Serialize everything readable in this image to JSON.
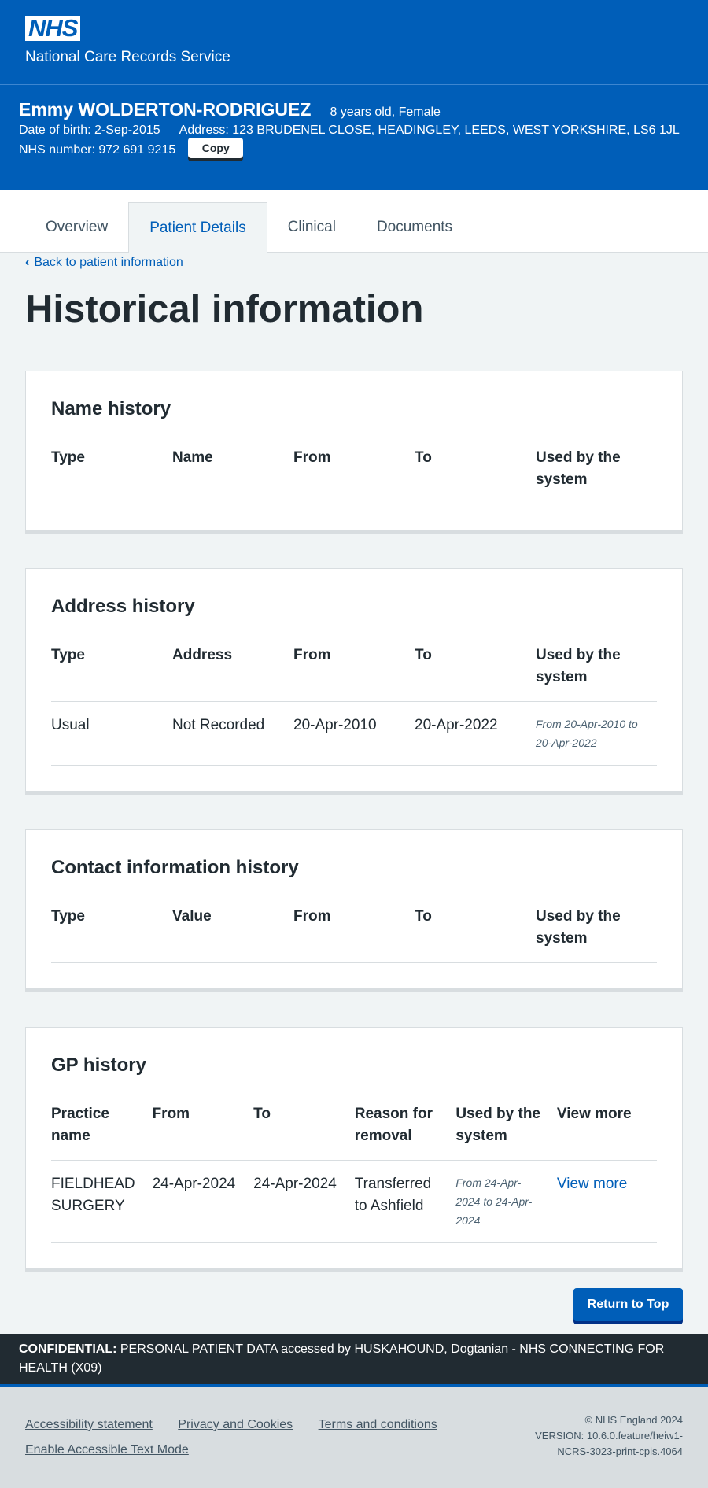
{
  "header": {
    "logo_text": "NHS",
    "service_name": "National Care Records Service"
  },
  "patient": {
    "name": "Emmy WOLDERTON-RODRIGUEZ",
    "age_sex": "8 years old, Female",
    "dob": "Date of birth: 2-Sep-2015",
    "address": "Address: 123 BRUDENEL CLOSE, HEADINGLEY, LEEDS, WEST YORKSHIRE, LS6 1JL",
    "nhs_number": "NHS number: 972 691 9215",
    "copy_label": "Copy"
  },
  "tabs": [
    {
      "label": "Overview"
    },
    {
      "label": "Patient Details"
    },
    {
      "label": "Clinical"
    },
    {
      "label": "Documents"
    }
  ],
  "back_link": "Back to patient information",
  "page_title": "Historical information",
  "name_history": {
    "title": "Name history",
    "headers": [
      "Type",
      "Name",
      "From",
      "To",
      "Used by the system"
    ]
  },
  "address_history": {
    "title": "Address history",
    "headers": [
      "Type",
      "Address",
      "From",
      "To",
      "Used by the system"
    ],
    "rows": [
      [
        "Usual",
        "Not Recorded",
        "20-Apr-2010",
        "20-Apr-2022",
        "From 20-Apr-2010 to 20-Apr-2022"
      ]
    ]
  },
  "contact_history": {
    "title": "Contact information history",
    "headers": [
      "Type",
      "Value",
      "From",
      "To",
      "Used by the system"
    ]
  },
  "gp_history": {
    "title": "GP history",
    "headers": [
      "Practice name",
      "From",
      "To",
      "Reason for removal",
      "Used by the system",
      "View more"
    ],
    "rows": [
      [
        "FIELDHEAD SURGERY",
        "24-Apr-2024",
        "24-Apr-2024",
        "Transferred to Ashfield",
        "From 24-Apr-2024 to 24-Apr-2024",
        "View more"
      ]
    ]
  },
  "return_to_top": "Return to Top",
  "confidential": {
    "label": "CONFIDENTIAL:",
    "text": " PERSONAL PATIENT DATA accessed by HUSKAHOUND, Dogtanian - NHS CONNECTING FOR HEALTH (X09)"
  },
  "footer": {
    "links": [
      "Accessibility statement",
      "Privacy and Cookies",
      "Terms and conditions",
      "Enable Accessible Text Mode"
    ],
    "copyright": "© NHS England 2024",
    "version_line1": "VERSION: 10.6.0.feature/heiw1-",
    "version_line2": "NCRS-3023-print-cpis.4064"
  }
}
